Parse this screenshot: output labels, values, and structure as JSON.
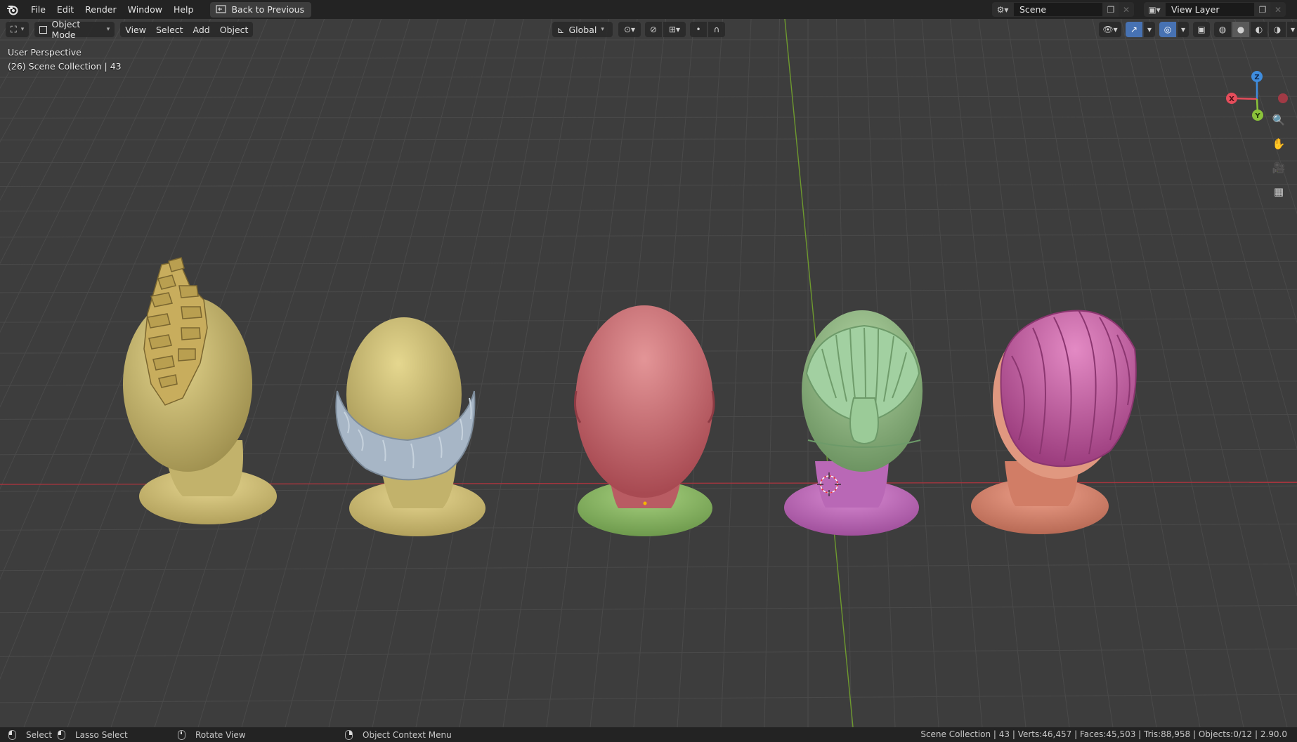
{
  "menu": {
    "items": [
      "File",
      "Edit",
      "Render",
      "Window",
      "Help"
    ],
    "back_button": "Back to Previous"
  },
  "scene_selector": {
    "value": "Scene"
  },
  "view_layer_selector": {
    "value": "View Layer"
  },
  "viewport_header": {
    "mode": "Object Mode",
    "menus": [
      "View",
      "Select",
      "Add",
      "Object"
    ],
    "transform_orientation": "Global"
  },
  "viewport": {
    "perspective_label": "User Perspective",
    "collection_label": "(26) Scene Collection | 43"
  },
  "gizmo": {
    "axes": {
      "z": "Z",
      "x": "X",
      "y": "Y"
    },
    "colors": {
      "x": "#e54d5b",
      "y": "#8ac23a",
      "z": "#3f8dde"
    }
  },
  "heads": [
    {
      "name": "golden-spiky-hair",
      "head_color": "#d1c27a",
      "base_color": "#d9c97e",
      "hair_color": "#b89e4f"
    },
    {
      "name": "yellow-with-fur-collar",
      "head_color": "#cfc17a",
      "base_color": "#d9c97e",
      "hair_color": "#9fb0c2"
    },
    {
      "name": "bald-pink",
      "head_color": "#cf6a6e",
      "base_color": "#8cbf65",
      "hair_color": ""
    },
    {
      "name": "green-ponytail",
      "head_color": "#8fb481",
      "base_color": "#c472bf",
      "hair_color": "#98c79a"
    },
    {
      "name": "pink-swept-hair",
      "head_color": "#e08a70",
      "base_color": "#e08a72",
      "hair_color": "#cb5fa6"
    }
  ],
  "statusbar": {
    "select": "Select",
    "lasso_select": "Lasso Select",
    "rotate_view": "Rotate View",
    "context_menu": "Object Context Menu",
    "stats": "Scene Collection | 43 | Verts:46,457 | Faces:45,503 | Tris:88,958 | Objects:0/12 | 2.90.0"
  }
}
